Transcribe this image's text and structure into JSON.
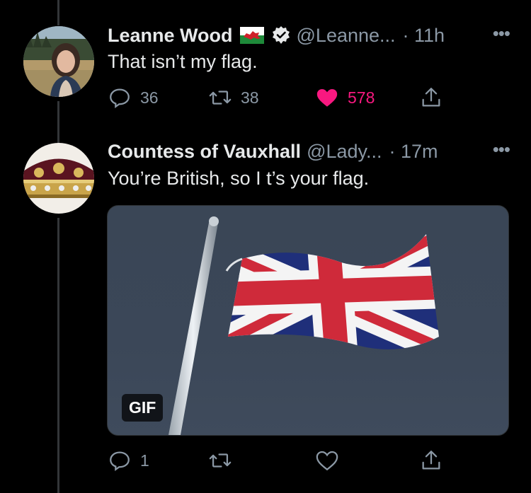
{
  "tweets": [
    {
      "name": "Leanne Wood",
      "handle": "@Leanne...",
      "time": "· 11h",
      "text": "That isn’t my flag.",
      "replies": "36",
      "retweets": "38",
      "likes": "578",
      "liked": true
    },
    {
      "name": "Countess of Vauxhall",
      "handle": "@Lady...",
      "time": "· 17m",
      "text": "You’re British, so I t’s your flag.",
      "replies": "1",
      "retweets": "",
      "likes": "",
      "liked": false,
      "media_badge": "GIF"
    }
  ],
  "more_glyph": "•••",
  "colors": {
    "background": "#000000",
    "secondary_text": "#8b98a5",
    "like": "#f91880"
  },
  "icons": [
    "reply-icon",
    "retweet-icon",
    "heart-icon",
    "share-icon",
    "verified-icon",
    "welsh-flag-icon"
  ]
}
